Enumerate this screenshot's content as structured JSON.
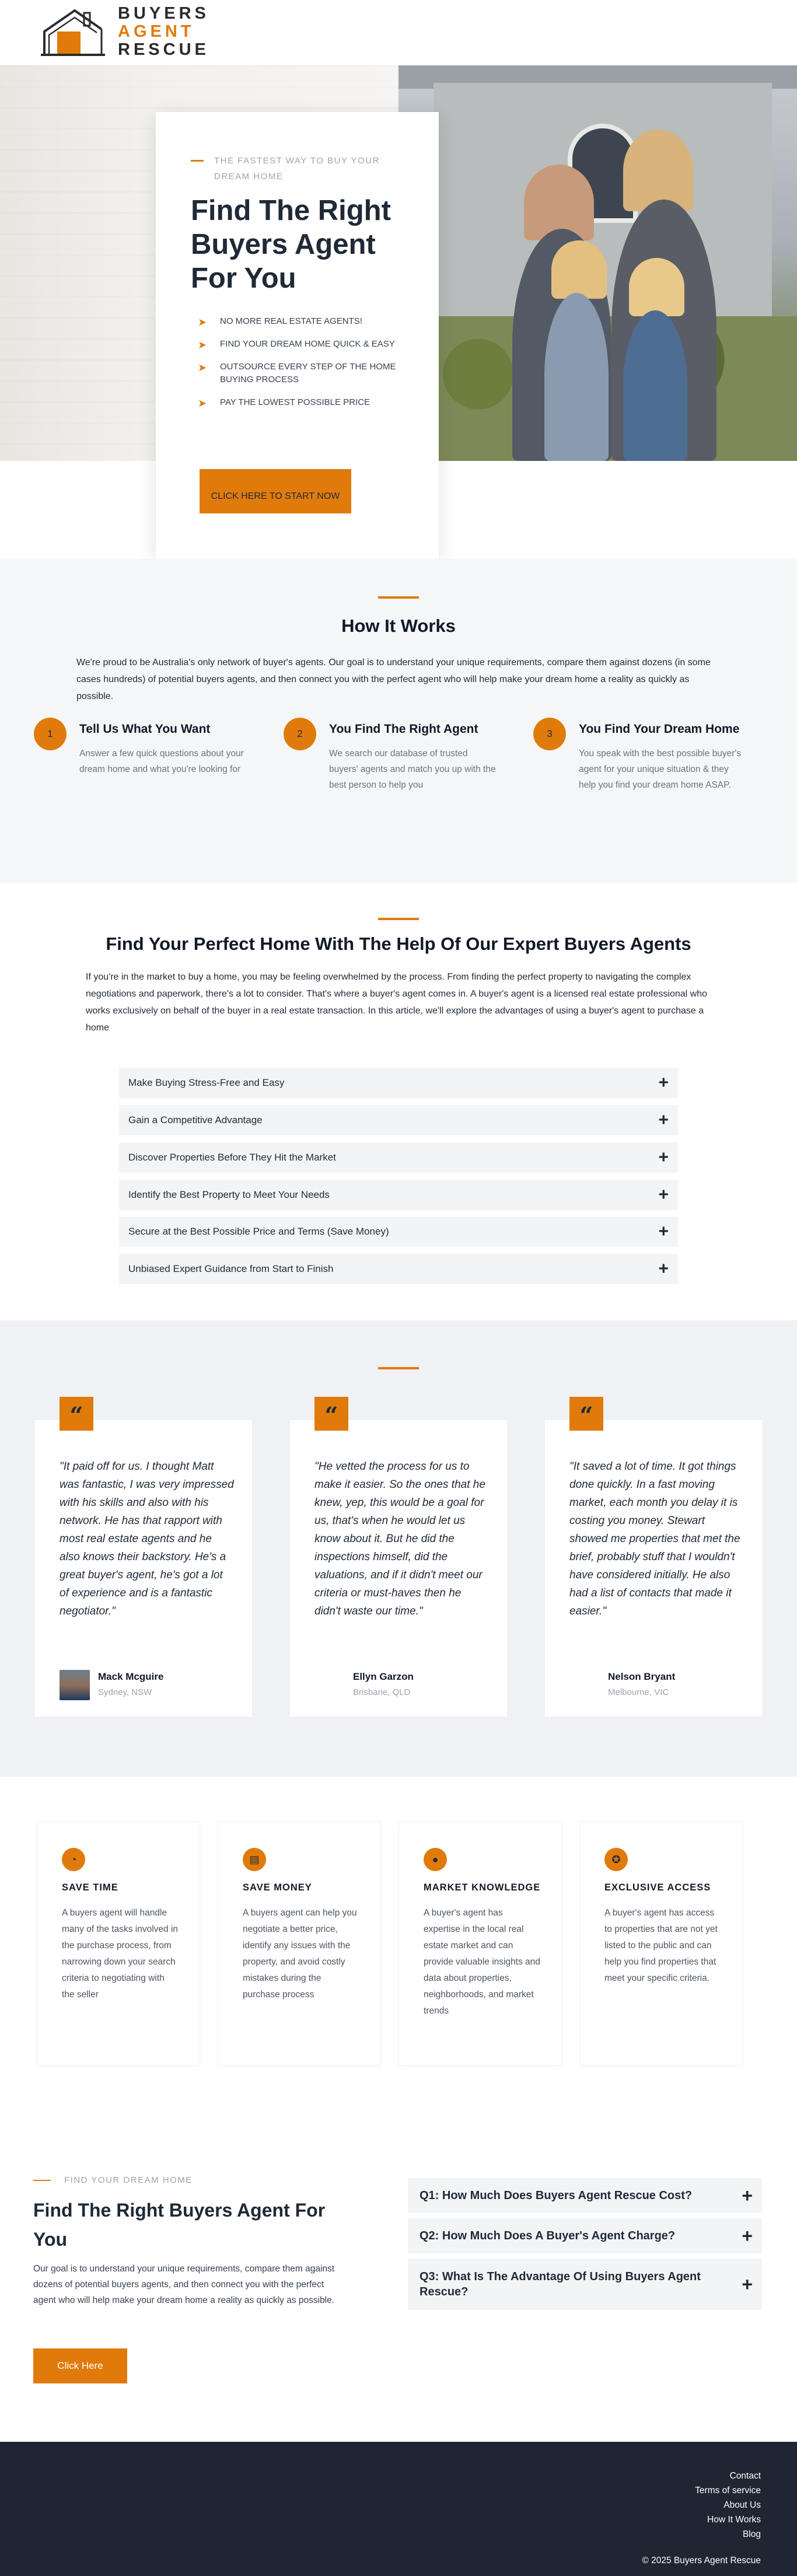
{
  "brand": {
    "logo_line1": "BUYERS",
    "logo_line2": "AGENT",
    "logo_line3": "RESCUE",
    "accent_color": "#e07b0b",
    "dark_color": "#1f2532"
  },
  "hero": {
    "eyebrow": "THE FASTEST WAY TO BUY YOUR DREAM HOME",
    "title": "Find The Right Buyers Agent For You",
    "checklist": [
      "NO MORE REAL ESTATE AGENTS!",
      "FIND YOUR DREAM HOME QUICK & EASY",
      "OUTSOURCE EVERY STEP OF THE HOME BUYING PROCESS",
      "PAY THE LOWEST POSSIBLE PRICE"
    ],
    "cta_label": "CLICK HERE TO START NOW"
  },
  "how_it_works": {
    "title": "How It Works",
    "intro": "We're proud to be Australia's only network of buyer's agents. Our goal is to understand your unique requirements, compare them against dozens (in some cases hundreds) of potential buyers agents, and then connect you with the perfect agent who will help make your dream home a reality as quickly as possible.",
    "steps": [
      {
        "num": "1",
        "title": "Tell Us What You Want",
        "text": "Answer a few quick questions about your dream home and what you're looking for"
      },
      {
        "num": "2",
        "title": "You Find The Right Agent",
        "text": "We search our database of trusted buyers' agents and match you up with the best person to help you"
      },
      {
        "num": "3",
        "title": "You Find Your Dream Home",
        "text": "You speak with the best possible buyer's agent for your unique situation & they help you find your dream home ASAP."
      }
    ]
  },
  "perfect_home": {
    "title": "Find Your Perfect Home With The Help Of Our Expert Buyers Agents",
    "intro": "If you're in the market to buy a home, you may be feeling overwhelmed by the process. From finding the perfect property to navigating the complex negotiations and paperwork, there's a lot to consider. That's where a buyer's agent comes in. A buyer's agent is a licensed real estate professional who works exclusively on behalf of the buyer in a real estate transaction. In this article, we'll explore the advantages of using a buyer's agent to purchase a home",
    "accordion": [
      "Make Buying Stress-Free and Easy",
      "Gain a Competitive Advantage",
      "Discover Properties Before They Hit the Market",
      "Identify the Best Property to Meet Your Needs",
      "Secure at the Best Possible Price and Terms (Save Money)",
      "Unbiased Expert Guidance from Start to Finish"
    ],
    "plus_glyph": "+"
  },
  "testimonials": [
    {
      "quote": "\"It paid off for us. I thought Matt was fantastic, I was very impressed with his skills and also with his network. He has that rapport with most real estate agents and he also knows their backstory. He's a great buyer's agent, he's got a lot of experience and is a fantastic negotiator.\"",
      "name": "Mack Mcguire",
      "location": "Sydney, NSW"
    },
    {
      "quote": "\"He vetted the process for us to make it easier. So the ones that he knew, yep, this would be a goal for us, that's when he would let us know about it. But he did the inspections himself, did the valuations, and if it didn't meet our criteria or must-haves then he didn't waste our time.\"",
      "name": "Ellyn Garzon",
      "location": "Brisbane, QLD"
    },
    {
      "quote": "\"It saved a lot of time. It got things done quickly. In a fast moving market, each month you delay it is costing you money. Stewart showed me properties that met the brief, probably stuff that I wouldn't have considered initially. He also had a list of contacts that made it easier.\"",
      "name": "Nelson Bryant",
      "location": "Melbourne, VIC"
    }
  ],
  "quote_glyph": "“",
  "features": [
    {
      "icon": "stopwatch-icon",
      "title": "SAVE TIME",
      "text": "A buyers agent will handle many of the tasks involved in the purchase process, from narrowing down your search criteria to negotiating with the seller"
    },
    {
      "icon": "wallet-icon",
      "title": "SAVE MONEY",
      "text": "A buyers agent can help you negotiate a better price, identify any issues with the property, and avoid costly mistakes during the purchase process"
    },
    {
      "icon": "lightbulb-icon",
      "title": "MARKET KNOWLEDGE",
      "text": "A buyer's agent has expertise in the local real estate market and can provide valuable insights and data about properties, neighborhoods, and market trends"
    },
    {
      "icon": "medal-icon",
      "title": "EXCLUSIVE ACCESS",
      "text": "A buyer's agent has access to properties that are not yet listed to the public and can help you find properties that meet your specific criteria."
    }
  ],
  "cta": {
    "eyebrow": "FIND YOUR DREAM HOME",
    "title": "Find The Right Buyers Agent For You",
    "text": "Our goal is to understand your unique requirements, compare them against dozens of potential buyers agents, and then connect you with the perfect agent who will help make your dream home a reality as quickly as possible.",
    "button": "Click Here"
  },
  "faq": [
    "Q1: How Much Does Buyers Agent Rescue Cost?",
    "Q2: How Much Does A Buyer's Agent Charge?",
    "Q3: What Is The Advantage Of Using Buyers Agent Rescue?"
  ],
  "footer": {
    "links": [
      "Contact",
      "Terms of service",
      "About Us",
      "How It Works",
      "Blog"
    ],
    "copyright": "© 2025 Buyers Agent Rescue"
  }
}
